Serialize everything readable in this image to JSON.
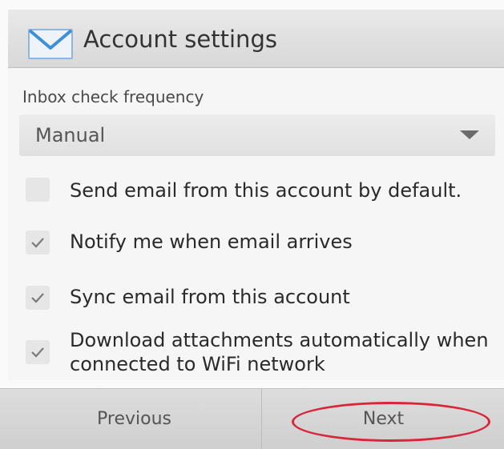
{
  "header": {
    "title": "Account settings",
    "icon": "envelope-icon"
  },
  "inbox": {
    "label": "Inbox check frequency",
    "selected": "Manual"
  },
  "options": [
    {
      "label": "Send email from this account by default.",
      "checked": false
    },
    {
      "label": "Notify me when email arrives",
      "checked": true
    },
    {
      "label": "Sync email from this account",
      "checked": true
    },
    {
      "label": "Download attachments automatically when connected to WiFi network",
      "checked": true
    }
  ],
  "footer": {
    "previous_label": "Previous",
    "next_label": "Next"
  },
  "colors": {
    "highlight": "#d9263a",
    "envelope_stroke": "#3f8fd6",
    "checkmark": "#7a7a7a"
  }
}
